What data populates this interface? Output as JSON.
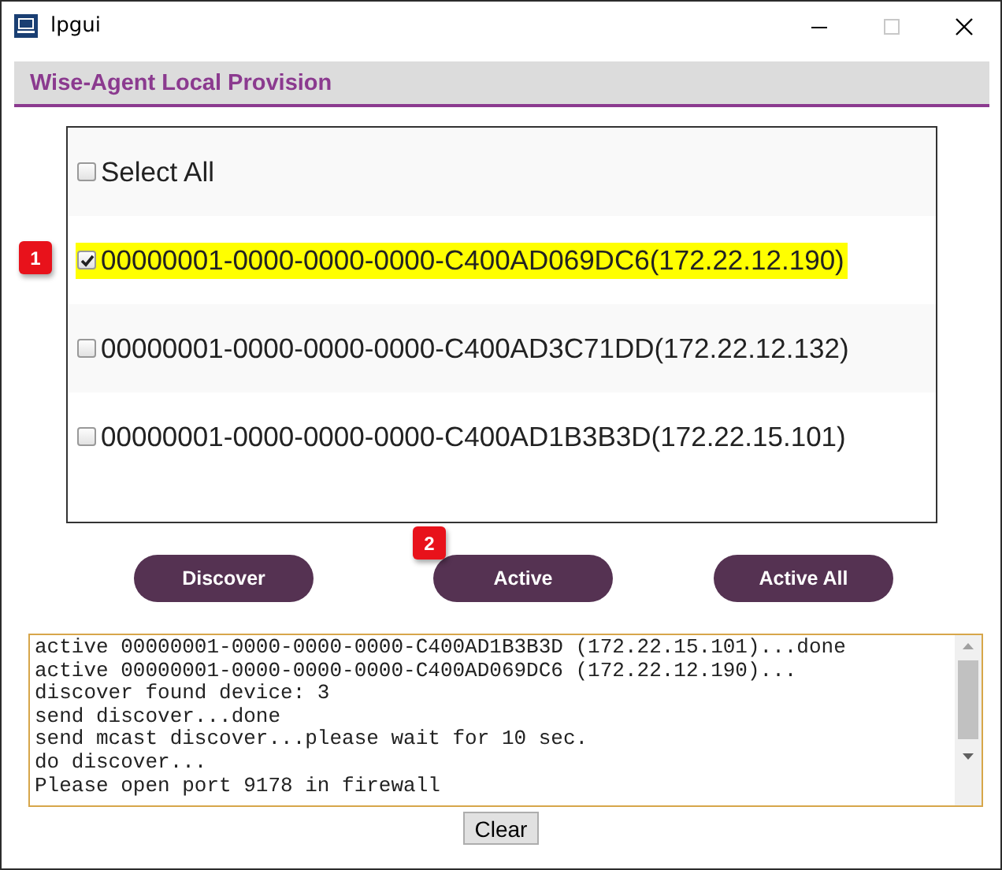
{
  "window": {
    "title": "lpgui",
    "maximize_disabled": true
  },
  "header": {
    "title": "Wise-Agent Local Provision"
  },
  "device_list": {
    "select_all": {
      "label": "Select All",
      "checked": false
    },
    "devices": [
      {
        "label": "00000001-0000-0000-0000-C400AD069DC6(172.22.12.190)",
        "checked": true,
        "highlighted": true
      },
      {
        "label": "00000001-0000-0000-0000-C400AD3C71DD(172.22.12.132)",
        "checked": false,
        "highlighted": false
      },
      {
        "label": "00000001-0000-0000-0000-C400AD1B3B3D(172.22.15.101)",
        "checked": false,
        "highlighted": false
      }
    ]
  },
  "buttons": [
    "Discover",
    "Active",
    "Active All"
  ],
  "log": {
    "lines": [
      "active 00000001-0000-0000-0000-C400AD1B3B3D (172.22.15.101)...done",
      "active 00000001-0000-0000-0000-C400AD069DC6 (172.22.12.190)...",
      "discover found device: 3",
      "send discover...done",
      "send mcast discover...please wait for 10 sec.",
      "do discover...",
      "Please open port 9178 in firewall"
    ]
  },
  "clear_button": "Clear",
  "callouts": [
    "1",
    "2"
  ]
}
